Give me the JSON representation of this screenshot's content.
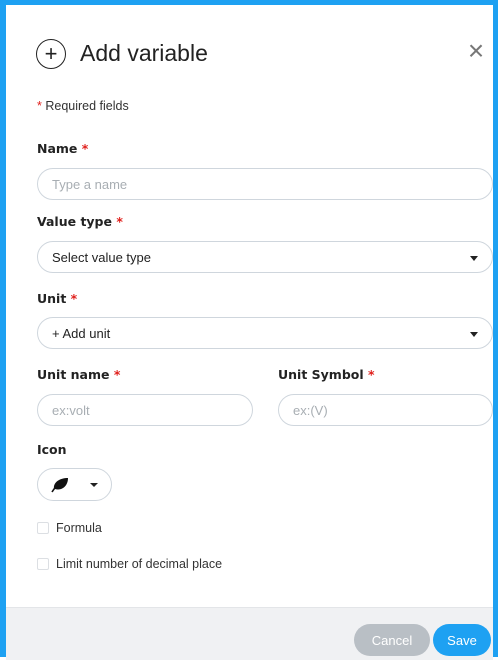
{
  "header": {
    "title": "Add variable",
    "add_icon": "+",
    "close_icon": "×"
  },
  "required_note": {
    "star": "*",
    "text": "Required fields"
  },
  "fields": {
    "name": {
      "label": "Name",
      "star": "*",
      "placeholder": "Type a name",
      "value": ""
    },
    "value_type": {
      "label": "Value type",
      "star": "*",
      "selected": "Select value type"
    },
    "unit": {
      "label": "Unit",
      "star": "*",
      "selected": "+ Add unit"
    },
    "unit_name": {
      "label": "Unit name",
      "star": "*",
      "placeholder": "ex:volt",
      "value": ""
    },
    "unit_symbol": {
      "label": "Unit Symbol",
      "star": "*",
      "placeholder": "ex:(V)",
      "value": ""
    },
    "icon": {
      "label": "Icon",
      "selected_icon": "leaf-icon"
    }
  },
  "options": {
    "formula": {
      "label": "Formula",
      "checked": false
    },
    "limit_decimal": {
      "label": "Limit number of decimal place",
      "checked": false
    }
  },
  "footer": {
    "cancel_label": "Cancel",
    "save_label": "Save"
  },
  "colors": {
    "accent": "#1ea1f2",
    "required": "#e0201c",
    "cancel_bg": "#b9bfc5",
    "footer_bg": "#f0f1f3"
  }
}
